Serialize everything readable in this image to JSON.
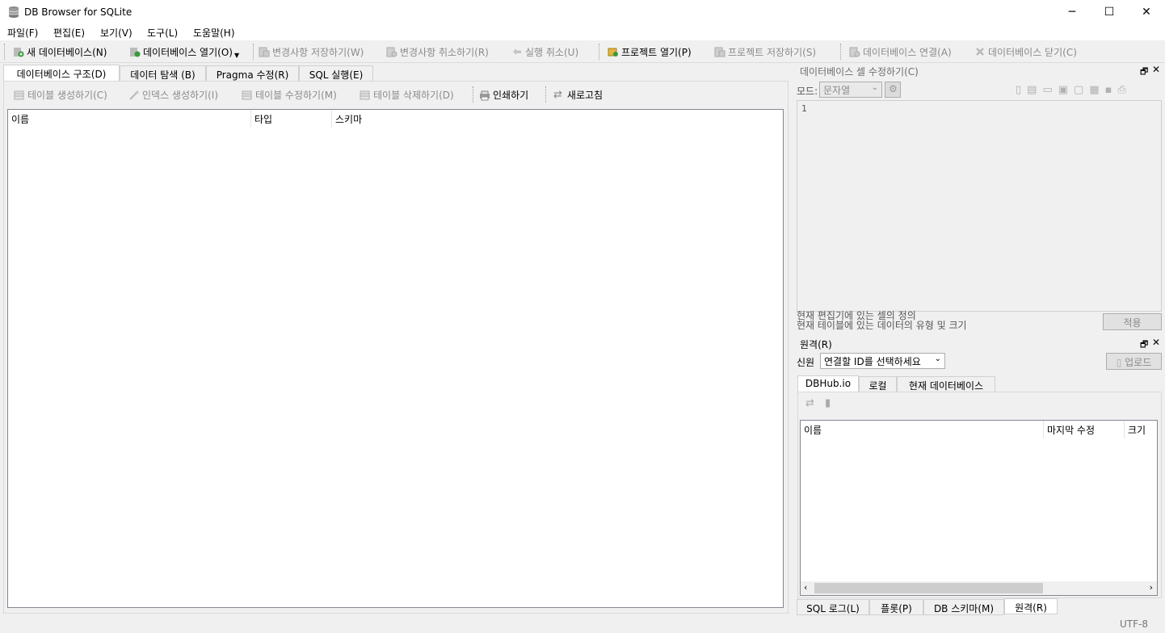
{
  "window": {
    "title": "DB Browser for SQLite",
    "controls": {
      "minimize": "─",
      "maximize": "☐",
      "close": "✕"
    }
  },
  "menu": [
    "파일(F)",
    "편집(E)",
    "보기(V)",
    "도구(L)",
    "도움말(H)"
  ],
  "toolbar": {
    "new_db": "새 데이터베이스(N)",
    "open_db": "데이터베이스 열기(O)",
    "write_changes": "변경사항 저장하기(W)",
    "revert_changes": "변경사항 취소하기(R)",
    "undo": "실행 취소(U)",
    "open_project": "프로젝트 열기(P)",
    "save_project": "프로젝트 저장하기(S)",
    "attach_db": "데이터베이스 연결(A)",
    "close_db": "데이터베이스 닫기(C)"
  },
  "tabs": [
    "데이터베이스 구조(D)",
    "데이터 탐색 (B)",
    "Pragma 수정(R)",
    "SQL 실행(E)"
  ],
  "structure_toolbar": {
    "create_table": "테이블 생성하기(C)",
    "create_index": "인덱스 생성하기(I)",
    "modify_table": "테이블 수정하기(M)",
    "delete_table": "테이블 삭제하기(D)",
    "print": "인쇄하기",
    "refresh": "새로고침"
  },
  "structure_columns": [
    "이름",
    "타입",
    "스키마"
  ],
  "cell_editor": {
    "title": "데이터베이스 셀 수정하기(C)",
    "mode_label": "모드:",
    "mode_value": "문자열",
    "line_number": "1",
    "info_line1": "현재 편집기에 있는 셀의 정의",
    "info_line2": "현재 테이블에 있는 데이터의 유형 및 크기",
    "apply": "적용"
  },
  "remote": {
    "title": "원격(R)",
    "identity_label": "신원",
    "identity_value": "연결할 ID를 선택하세요",
    "upload": "업로드",
    "tabs": [
      "DBHub.io",
      "로컬",
      "현재 데이터베이스"
    ],
    "columns": [
      "이름",
      "마지막 수정",
      "크기"
    ]
  },
  "bottom_tabs": [
    "SQL 로그(L)",
    "플롯(P)",
    "DB 스키마(M)",
    "원격(R)"
  ],
  "status": {
    "encoding": "UTF-8"
  }
}
